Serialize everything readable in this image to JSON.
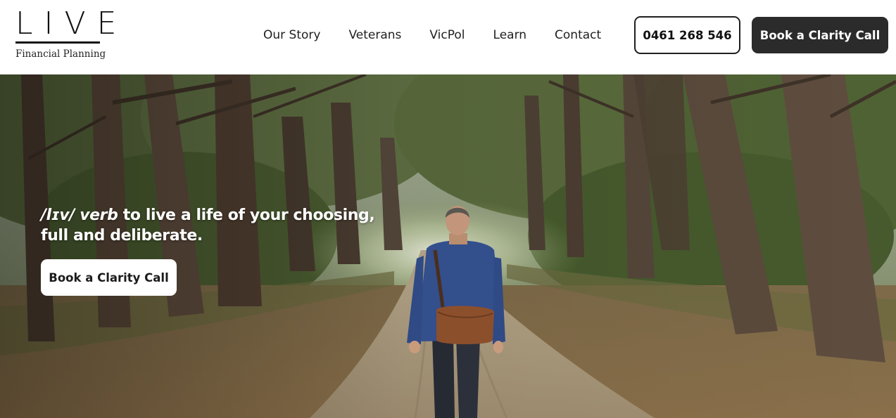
{
  "header": {
    "logo": {
      "word": "LIVE",
      "subtitle": "Financial Planning"
    },
    "nav": [
      {
        "label": "Our Story"
      },
      {
        "label": "Veterans"
      },
      {
        "label": "VicPol"
      },
      {
        "label": "Learn"
      },
      {
        "label": "Contact"
      }
    ],
    "phone_button": "0461 268 546",
    "cta_button": "Book a Clarity Call"
  },
  "hero": {
    "image": "forest-path-man-walking-with-satchel",
    "tagline": {
      "phonetic": "/lɪv/ verb",
      "line1": " to live a life of your choosing,",
      "line2": "full and deliberate."
    },
    "cta_button": "Book a Clarity Call"
  },
  "colors": {
    "header_background": "#ffffff",
    "text_dark": "#1b1b1b",
    "cta_background": "#2b2b2b",
    "cta_text": "#ffffff",
    "hero_button_background": "#ffffff"
  }
}
